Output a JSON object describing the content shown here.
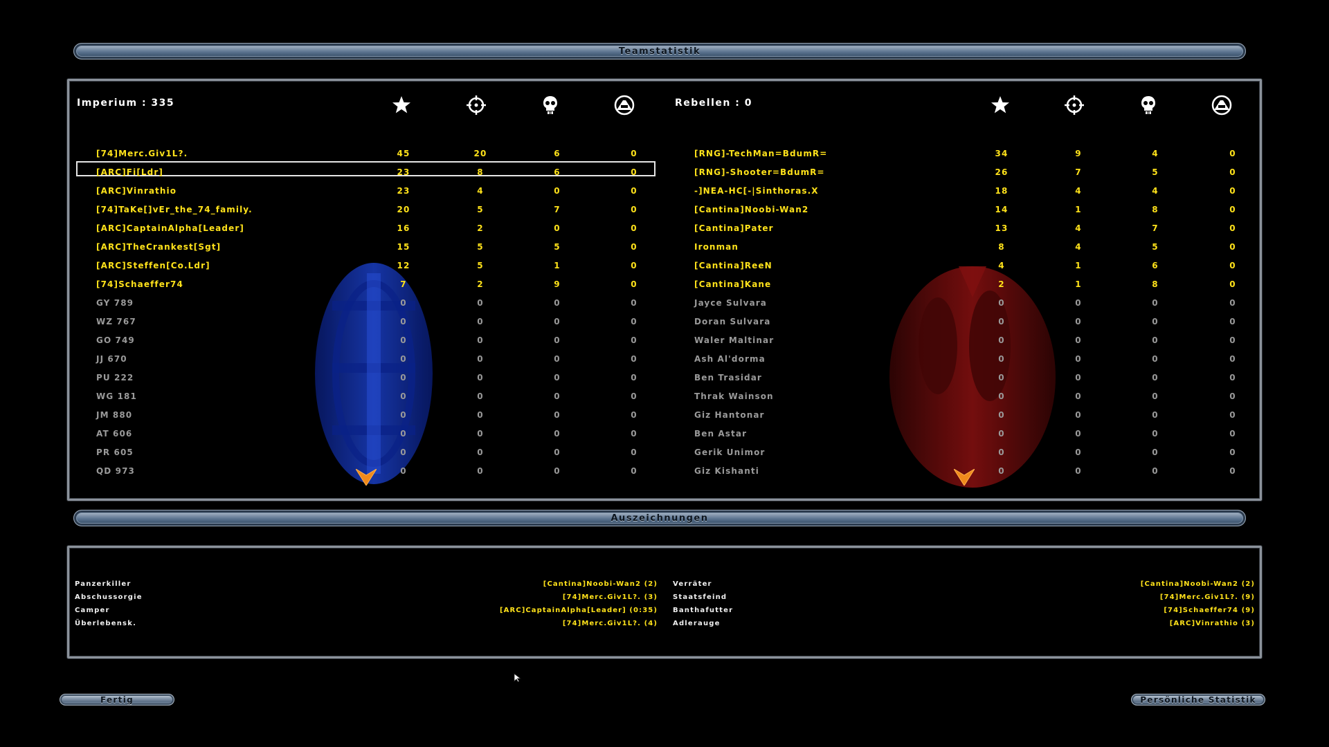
{
  "header": {
    "title": "Teamstatistik"
  },
  "empire": {
    "title": "Imperium : 335",
    "players": [
      {
        "name": "[74]Merc.Giv1L?.",
        "score": "45",
        "kills": "20",
        "deaths": "6",
        "vehicles": "0",
        "bot": false
      },
      {
        "name": "[ARC]Fi[Ldr]",
        "score": "23",
        "kills": "8",
        "deaths": "6",
        "vehicles": "0",
        "bot": false
      },
      {
        "name": "[ARC]Vinrathio",
        "score": "23",
        "kills": "4",
        "deaths": "0",
        "vehicles": "0",
        "bot": false
      },
      {
        "name": "[74]TaKe[]vEr_the_74_family.",
        "score": "20",
        "kills": "5",
        "deaths": "7",
        "vehicles": "0",
        "bot": false
      },
      {
        "name": "[ARC]CaptainAlpha[Leader]",
        "score": "16",
        "kills": "2",
        "deaths": "0",
        "vehicles": "0",
        "bot": false
      },
      {
        "name": "[ARC]TheCrankest[Sgt]",
        "score": "15",
        "kills": "5",
        "deaths": "5",
        "vehicles": "0",
        "bot": false
      },
      {
        "name": "[ARC]Steffen[Co.Ldr]",
        "score": "12",
        "kills": "5",
        "deaths": "1",
        "vehicles": "0",
        "bot": false
      },
      {
        "name": "[74]Schaeffer74",
        "score": "7",
        "kills": "2",
        "deaths": "9",
        "vehicles": "0",
        "bot": false
      },
      {
        "name": "GY 789",
        "score": "0",
        "kills": "0",
        "deaths": "0",
        "vehicles": "0",
        "bot": true
      },
      {
        "name": "WZ 767",
        "score": "0",
        "kills": "0",
        "deaths": "0",
        "vehicles": "0",
        "bot": true
      },
      {
        "name": "GO 749",
        "score": "0",
        "kills": "0",
        "deaths": "0",
        "vehicles": "0",
        "bot": true
      },
      {
        "name": "JJ 670",
        "score": "0",
        "kills": "0",
        "deaths": "0",
        "vehicles": "0",
        "bot": true
      },
      {
        "name": "PU 222",
        "score": "0",
        "kills": "0",
        "deaths": "0",
        "vehicles": "0",
        "bot": true
      },
      {
        "name": "WG 181",
        "score": "0",
        "kills": "0",
        "deaths": "0",
        "vehicles": "0",
        "bot": true
      },
      {
        "name": "JM 880",
        "score": "0",
        "kills": "0",
        "deaths": "0",
        "vehicles": "0",
        "bot": true
      },
      {
        "name": "AT 606",
        "score": "0",
        "kills": "0",
        "deaths": "0",
        "vehicles": "0",
        "bot": true
      },
      {
        "name": "PR 605",
        "score": "0",
        "kills": "0",
        "deaths": "0",
        "vehicles": "0",
        "bot": true
      },
      {
        "name": "QD 973",
        "score": "0",
        "kills": "0",
        "deaths": "0",
        "vehicles": "0",
        "bot": true
      }
    ]
  },
  "rebels": {
    "title": "Rebellen : 0",
    "players": [
      {
        "name": "[RNG]-TechMan=BdumR=",
        "score": "34",
        "kills": "9",
        "deaths": "4",
        "vehicles": "0",
        "bot": false
      },
      {
        "name": "[RNG]-Shooter=BdumR=",
        "score": "26",
        "kills": "7",
        "deaths": "5",
        "vehicles": "0",
        "bot": false
      },
      {
        "name": "-]NEA-HC[-|Sinthoras.X",
        "score": "18",
        "kills": "4",
        "deaths": "4",
        "vehicles": "0",
        "bot": false
      },
      {
        "name": "[Cantina]Noobi-Wan2",
        "score": "14",
        "kills": "1",
        "deaths": "8",
        "vehicles": "0",
        "bot": false
      },
      {
        "name": "[Cantina]Pater",
        "score": "13",
        "kills": "4",
        "deaths": "7",
        "vehicles": "0",
        "bot": false
      },
      {
        "name": "Ironman",
        "score": "8",
        "kills": "4",
        "deaths": "5",
        "vehicles": "0",
        "bot": false
      },
      {
        "name": "[Cantina]ReeN",
        "score": "4",
        "kills": "1",
        "deaths": "6",
        "vehicles": "0",
        "bot": false
      },
      {
        "name": "[Cantina]Kane",
        "score": "2",
        "kills": "1",
        "deaths": "8",
        "vehicles": "0",
        "bot": false
      },
      {
        "name": "Jayce Sulvara",
        "score": "0",
        "kills": "0",
        "deaths": "0",
        "vehicles": "0",
        "bot": true
      },
      {
        "name": "Doran Sulvara",
        "score": "0",
        "kills": "0",
        "deaths": "0",
        "vehicles": "0",
        "bot": true
      },
      {
        "name": "Waler Maltinar",
        "score": "0",
        "kills": "0",
        "deaths": "0",
        "vehicles": "0",
        "bot": true
      },
      {
        "name": "Ash Al'dorma",
        "score": "0",
        "kills": "0",
        "deaths": "0",
        "vehicles": "0",
        "bot": true
      },
      {
        "name": "Ben Trasidar",
        "score": "0",
        "kills": "0",
        "deaths": "0",
        "vehicles": "0",
        "bot": true
      },
      {
        "name": "Thrak Wainson",
        "score": "0",
        "kills": "0",
        "deaths": "0",
        "vehicles": "0",
        "bot": true
      },
      {
        "name": "Giz Hantonar",
        "score": "0",
        "kills": "0",
        "deaths": "0",
        "vehicles": "0",
        "bot": true
      },
      {
        "name": "Ben Astar",
        "score": "0",
        "kills": "0",
        "deaths": "0",
        "vehicles": "0",
        "bot": true
      },
      {
        "name": "Gerik Unimor",
        "score": "0",
        "kills": "0",
        "deaths": "0",
        "vehicles": "0",
        "bot": true
      },
      {
        "name": "Giz Kishanti",
        "score": "0",
        "kills": "0",
        "deaths": "0",
        "vehicles": "0",
        "bot": true
      }
    ]
  },
  "columns": [
    "star-icon",
    "crosshair-icon",
    "skull-icon",
    "vehicle-icon"
  ],
  "awards": {
    "title": "Auszeichnungen",
    "left": [
      {
        "label": "Panzerkiller",
        "value": "[Cantina]Noobi-Wan2 (2)"
      },
      {
        "label": "Abschussorgie",
        "value": "[74]Merc.Giv1L?. (3)"
      },
      {
        "label": "Camper",
        "value": "[ARC]CaptainAlpha[Leader] (0:35)"
      },
      {
        "label": "Überlebensk.",
        "value": "[74]Merc.Giv1L?. (4)"
      }
    ],
    "right": [
      {
        "label": "Verräter",
        "value": "[Cantina]Noobi-Wan2 (2)"
      },
      {
        "label": "Staatsfeind",
        "value": "[74]Merc.Giv1L?. (9)"
      },
      {
        "label": "Banthafutter",
        "value": "[74]Schaeffer74 (9)"
      },
      {
        "label": "Adlerauge",
        "value": "[ARC]Vinrathio (3)"
      }
    ]
  },
  "buttons": {
    "done": "Fertig",
    "personal_stats": "Persönliche Statistik"
  },
  "colors": {
    "player": "#ffe21a",
    "bot": "#9a9a9a",
    "empire_emblem": "#1a3fd0",
    "rebel_emblem": "#a81515",
    "arrow": "#f08a1c"
  }
}
